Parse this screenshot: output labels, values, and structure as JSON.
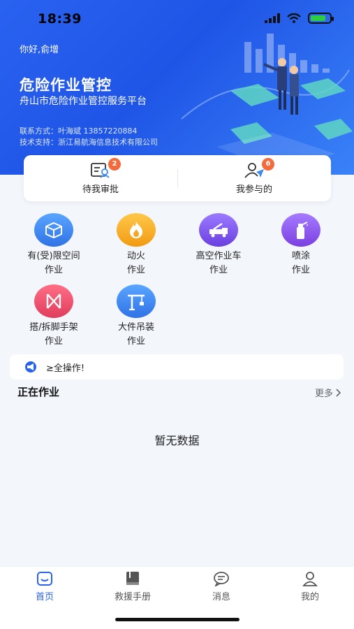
{
  "status_bar": {
    "time": "18:39"
  },
  "header": {
    "greeting": "你好,俞增",
    "title": "危险作业管控",
    "subtitle": "舟山市危险作业管控服务平台",
    "contact_line": "联系方式：叶海斌 13857220884",
    "support_line": "技术支持：浙江易航海信息技术有限公司"
  },
  "approvals": [
    {
      "label": "待我审批",
      "badge": "2",
      "icon": "approval-doc-icon"
    },
    {
      "label": "我参与的",
      "badge": "6",
      "icon": "user-send-icon"
    }
  ],
  "work_types": [
    {
      "label": "有(受)限空间\n作业",
      "icon": "box-icon",
      "color": "#3d8bf0"
    },
    {
      "label": "动火\n作业",
      "icon": "fire-icon",
      "color": "#f5a623"
    },
    {
      "label": "高空作业车\n作业",
      "icon": "truck-icon",
      "color": "#7b55e6"
    },
    {
      "label": "喷涂\n作业",
      "icon": "spray-icon",
      "color": "#8a4fe8"
    },
    {
      "label": "搭/拆脚手架\n作业",
      "icon": "scaffold-icon",
      "color": "#ea4a6a"
    },
    {
      "label": "大件吊装\n作业",
      "icon": "crane-icon",
      "color": "#3d8bf0"
    }
  ],
  "notice": {
    "text": "≥全操作!"
  },
  "section": {
    "title": "正在作业",
    "more": "更多"
  },
  "empty_text": "暂无数据",
  "tabbar": [
    {
      "label": "首页",
      "icon": "home-icon",
      "active": true
    },
    {
      "label": "救援手册",
      "icon": "book-icon",
      "active": false
    },
    {
      "label": "消息",
      "icon": "message-icon",
      "active": false
    },
    {
      "label": "我的",
      "icon": "profile-icon",
      "active": false
    }
  ],
  "colors": {
    "primary": "#2a62f0",
    "badge": "#f36b3d",
    "tab_active": "#2a62f0",
    "tab_inactive": "#666666"
  }
}
